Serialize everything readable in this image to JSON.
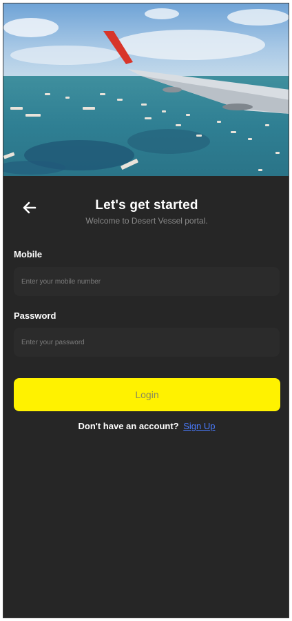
{
  "header": {
    "title": "Let's get started",
    "subtitle": "Welcome to Desert Vessel portal."
  },
  "form": {
    "mobile_label": "Mobile",
    "mobile_placeholder": "Enter your mobile number",
    "password_label": "Password",
    "password_placeholder": "Enter your password",
    "login_label": "Login"
  },
  "footer": {
    "prompt": "Don't have an account?",
    "signup_label": "Sign Up"
  },
  "icons": {
    "back": "arrow-left-icon"
  },
  "colors": {
    "background": "#262626",
    "field": "#2b2b2b",
    "accent": "#fff200",
    "link": "#4a7cff"
  }
}
